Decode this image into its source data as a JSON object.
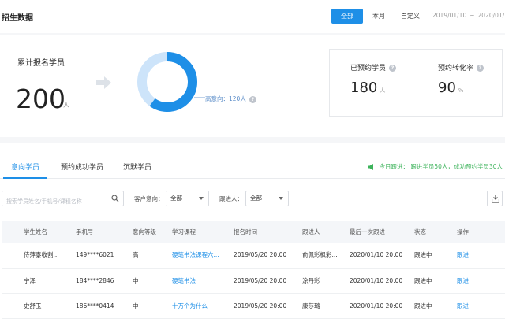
{
  "header": {
    "title": "招生数据",
    "range_buttons": [
      "全部",
      "本月",
      "自定义"
    ],
    "date_start": "2019/01/10",
    "date_sep": "~",
    "date_end": "2020/01/10"
  },
  "stats": {
    "total_label": "累计报名学员",
    "total_value": "200",
    "total_unit": "人",
    "donut_label": "高意向：120人",
    "donut_share": 0.6,
    "colors": {
      "primary": "#1e8fe7",
      "secondary": "#cde4fa"
    }
  },
  "kpis": [
    {
      "label": "已预约学员",
      "value": "180",
      "unit": "人"
    },
    {
      "label": "预约转化率",
      "value": "90",
      "unit": "%"
    }
  ],
  "tabs": [
    "意向学员",
    "预约成功学员",
    "沉默学员"
  ],
  "notice": "今日跟进： 跟进学员50人，成功预约学员30人",
  "filters": {
    "search_placeholder": "搜索学员姓名/手机号/课程名称",
    "intent_label": "客户意向：",
    "intent_value": "全部",
    "follower_label": "跟进人：",
    "follower_value": "全部"
  },
  "table": {
    "headers": [
      "学生姓名",
      "手机号",
      "意向等级",
      "学习课程",
      "报名时间",
      "跟进人",
      "最后一次跟进",
      "状态",
      "操作"
    ],
    "rows": [
      [
        "侍萍泰收割...",
        "149****6021",
        "高",
        "硬笔书法课程六...",
        "2019/05/20 20:00",
        "俞佩彩枫彩...",
        "2020/01/10 20:00",
        "跟进中",
        "跟进"
      ],
      [
        "宁泽",
        "184****2846",
        "中",
        "硬笔书法",
        "2019/05/20 20:00",
        "涂丹彩",
        "2020/01/10 20:00",
        "跟进中",
        "跟进"
      ],
      [
        "史舒玉",
        "186****0414",
        "中",
        "十万个为什么",
        "2019/05/20 20:00",
        "康莎璐",
        "2020/01/10 20:00",
        "跟进中",
        "跟进"
      ]
    ]
  }
}
